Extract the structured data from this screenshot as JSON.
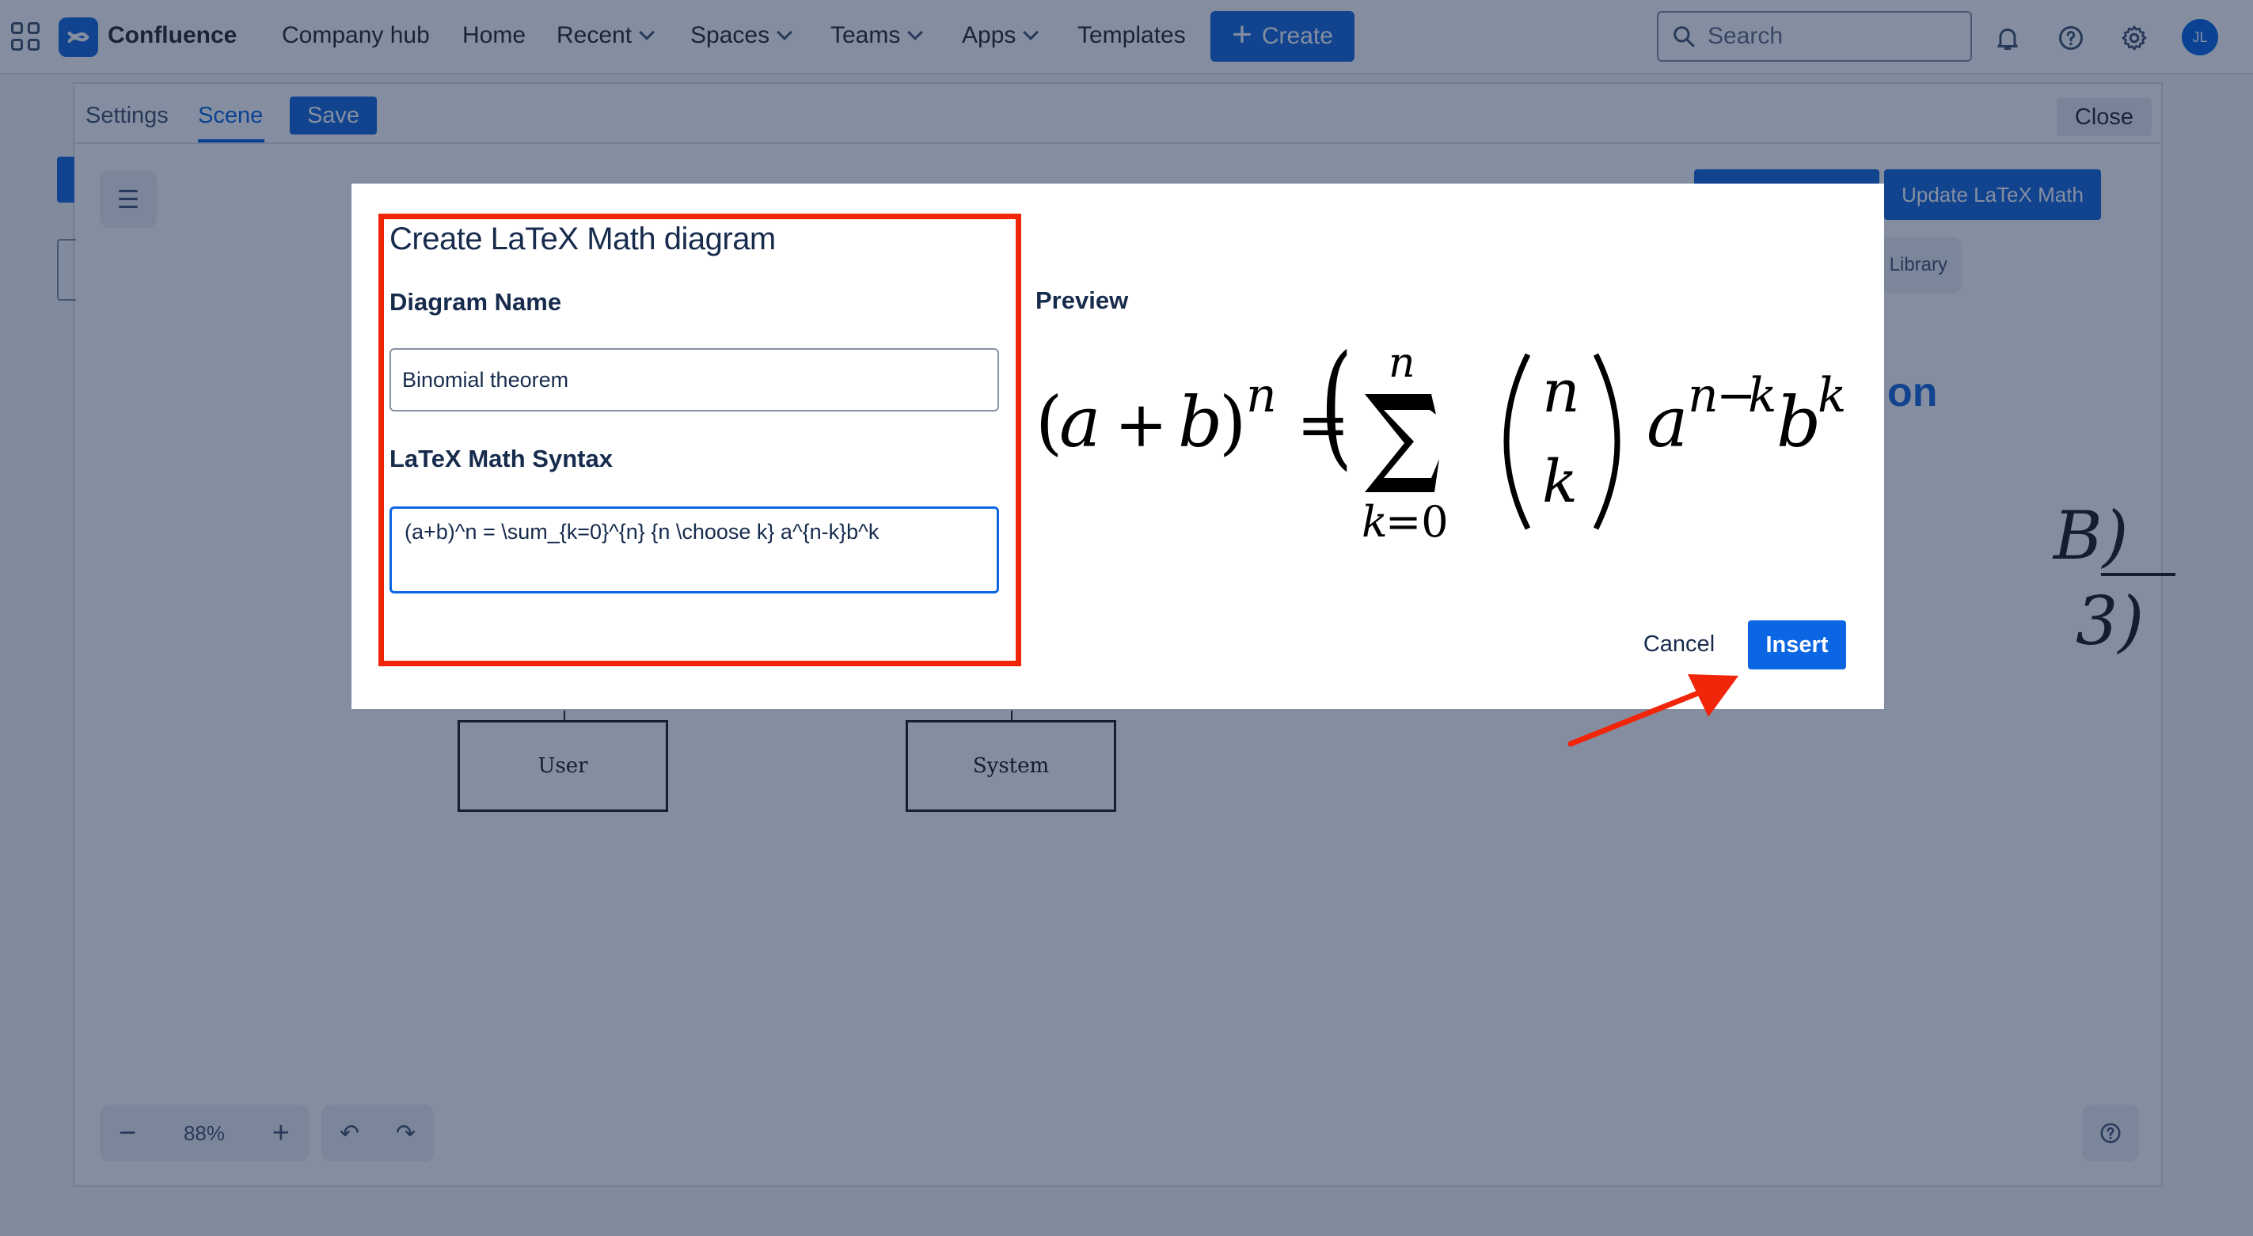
{
  "topnav": {
    "brand": "Confluence",
    "items": [
      {
        "label": "Company hub",
        "has_dropdown": false
      },
      {
        "label": "Home",
        "has_dropdown": false
      },
      {
        "label": "Recent",
        "has_dropdown": true
      },
      {
        "label": "Spaces",
        "has_dropdown": true
      },
      {
        "label": "Teams",
        "has_dropdown": true
      },
      {
        "label": "Apps",
        "has_dropdown": true
      },
      {
        "label": "Templates",
        "has_dropdown": false
      }
    ],
    "create_label": "Create",
    "search_placeholder": "Search",
    "avatar_initials": "JL",
    "icons": [
      "apps-grid-icon",
      "confluence-logo-icon",
      "search-icon",
      "bell-icon",
      "help-icon",
      "gear-icon"
    ]
  },
  "editor": {
    "tabs": [
      "Settings",
      "Scene"
    ],
    "active_tab": "Scene",
    "save_label": "Save",
    "close_label": "Close",
    "update_latex_label": "Update LaTeX Math",
    "library_label": "Library",
    "zoom_level": "88%",
    "zoom_out": "−",
    "zoom_in": "+",
    "canvas_boxes": [
      "User",
      "System"
    ],
    "background_fragments": [
      "on",
      "B)",
      "3)"
    ]
  },
  "modal": {
    "title": "Create LaTeX Math diagram",
    "name_label": "Diagram Name",
    "name_value": "Binomial theorem",
    "syntax_label": "LaTeX Math Syntax",
    "syntax_value": "(a+b)^n = \\sum_{k=0}^{n} {n \\choose k} a^{n-k}b^k",
    "preview_label": "Preview",
    "cancel_label": "Cancel",
    "insert_label": "Insert"
  },
  "colors": {
    "primary": "#0c66e4",
    "brand": "#1868db",
    "annotation_red": "#f1250a",
    "overlay": "rgba(9,30,66,0.50)"
  }
}
